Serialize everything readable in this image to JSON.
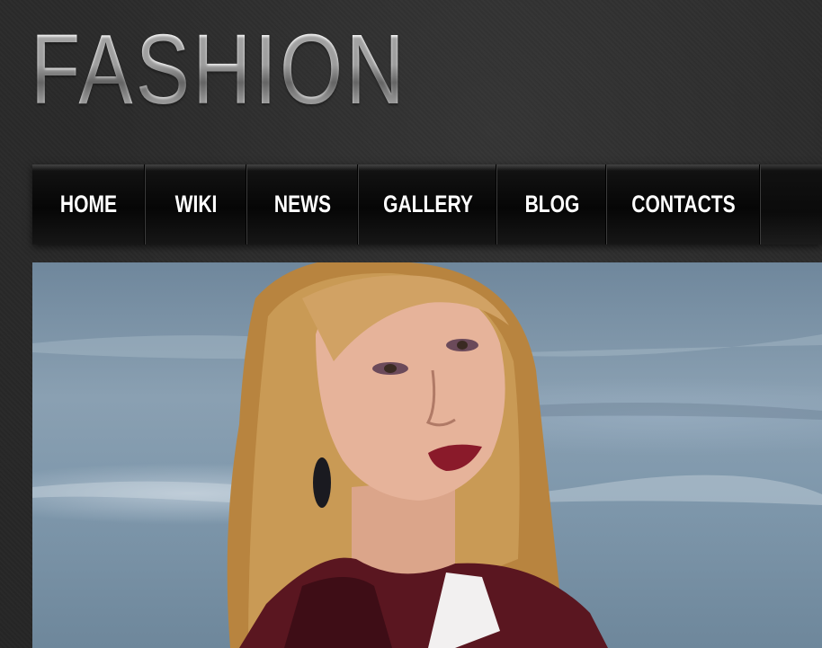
{
  "site": {
    "logo_text": "FASHION"
  },
  "nav": {
    "items": [
      {
        "label": "HOME"
      },
      {
        "label": "WIKI"
      },
      {
        "label": "NEWS"
      },
      {
        "label": "GALLERY"
      },
      {
        "label": "BLOG"
      },
      {
        "label": "CONTACTS"
      }
    ]
  },
  "hero": {
    "image_subject": "fashion model portrait"
  },
  "colors": {
    "background": "#2a2a2a",
    "nav_background": "#0b0b0b",
    "nav_text": "#ffffff"
  }
}
